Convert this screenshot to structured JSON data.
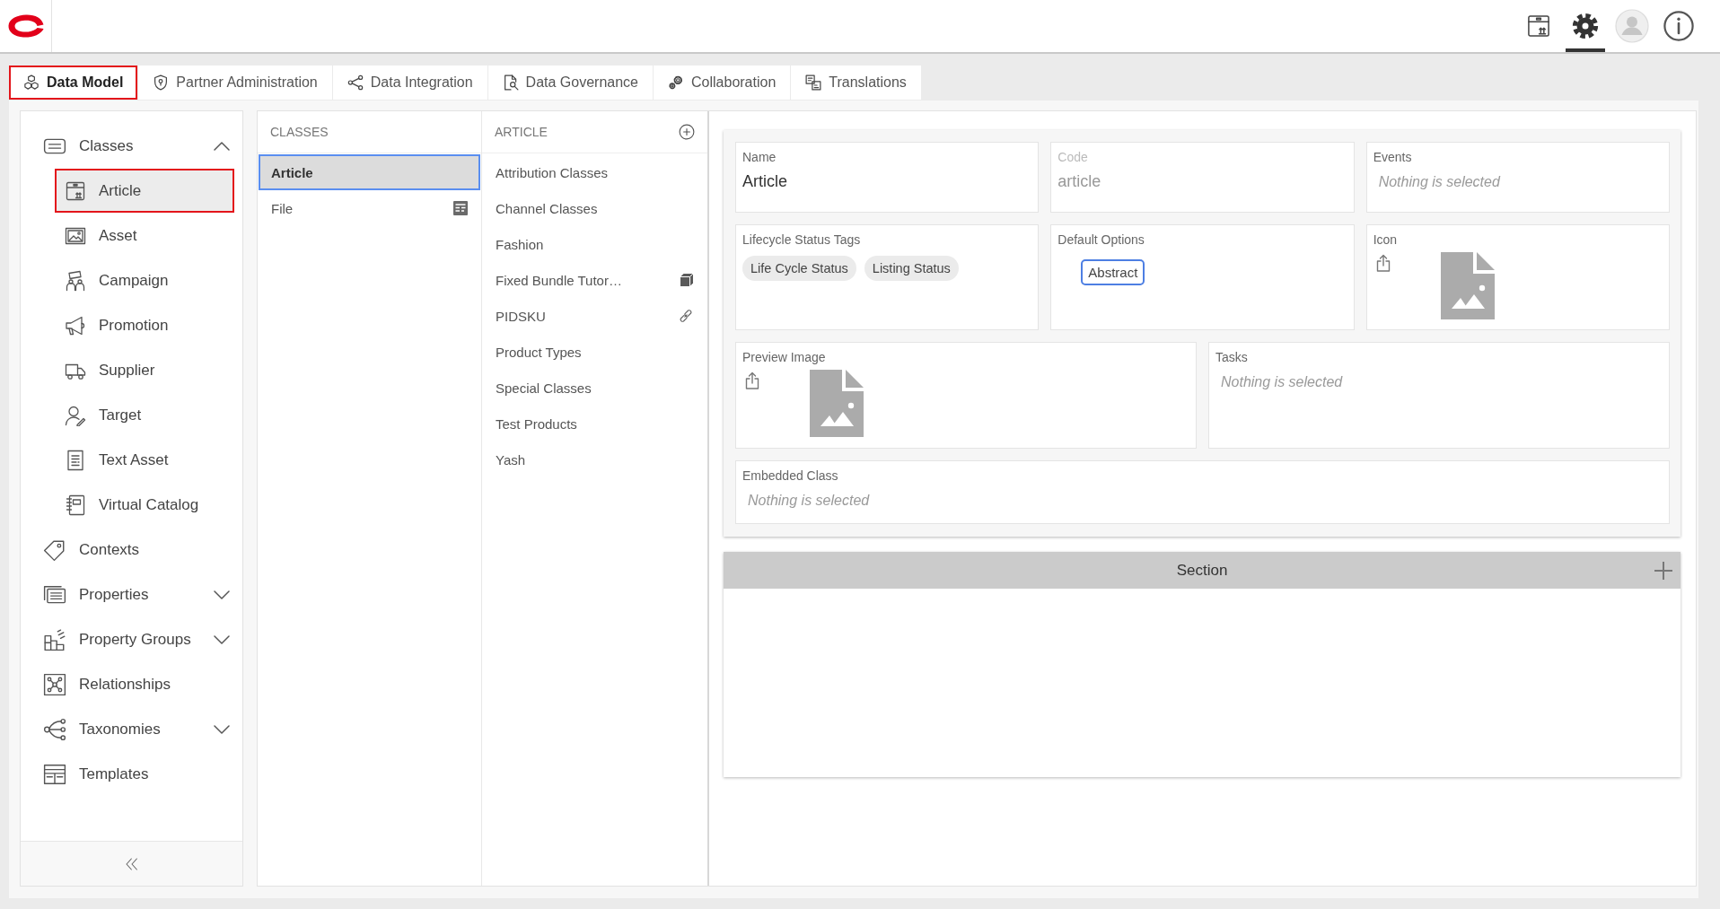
{
  "top_bar": {
    "actions": [
      {
        "kind": "package",
        "selected": false
      },
      {
        "kind": "settings",
        "selected": true
      },
      {
        "kind": "avatar",
        "selected": false
      },
      {
        "kind": "info",
        "selected": false
      }
    ]
  },
  "tabs": [
    {
      "label": "Data Model",
      "selected": true
    },
    {
      "label": "Partner Administration",
      "selected": false
    },
    {
      "label": "Data Integration",
      "selected": false
    },
    {
      "label": "Data Governance",
      "selected": false
    },
    {
      "label": "Collaboration",
      "selected": false
    },
    {
      "label": "Translations",
      "selected": false
    }
  ],
  "sidebar": {
    "items": [
      {
        "label": "Classes",
        "selected": false,
        "expanded": true,
        "children": [
          {
            "label": "Article",
            "selected": true
          },
          {
            "label": "Asset",
            "selected": false
          },
          {
            "label": "Campaign",
            "selected": false
          },
          {
            "label": "Promotion",
            "selected": false
          },
          {
            "label": "Supplier",
            "selected": false
          },
          {
            "label": "Target",
            "selected": false
          },
          {
            "label": "Text Asset",
            "selected": false
          },
          {
            "label": "Virtual Catalog",
            "selected": false
          }
        ]
      },
      {
        "label": "Contexts",
        "selected": false
      },
      {
        "label": "Properties",
        "selected": false,
        "expanded": false
      },
      {
        "label": "Property Groups",
        "selected": false,
        "expanded": false
      },
      {
        "label": "Relationships",
        "selected": false
      },
      {
        "label": "Taxonomies",
        "selected": false,
        "expanded": false
      },
      {
        "label": "Templates",
        "selected": false
      }
    ]
  },
  "classes_column": {
    "title": "CLASSES",
    "items": [
      {
        "label": "Article",
        "selected": true,
        "kind": "plain"
      },
      {
        "label": "File",
        "selected": false,
        "kind": "template"
      }
    ]
  },
  "article_column": {
    "title": "ARTICLE",
    "items": [
      {
        "label": "Attribution Classes",
        "selected": false,
        "kind": "plain"
      },
      {
        "label": "Channel Classes",
        "selected": false,
        "kind": "plain"
      },
      {
        "label": "Fashion",
        "selected": false,
        "kind": "plain"
      },
      {
        "label": "Fixed Bundle Tutor…",
        "selected": false,
        "kind": "bundle"
      },
      {
        "label": "PIDSKU",
        "selected": false,
        "kind": "linked"
      },
      {
        "label": "Product Types",
        "selected": false,
        "kind": "plain"
      },
      {
        "label": "Special Classes",
        "selected": false,
        "kind": "plain"
      },
      {
        "label": "Test Products",
        "selected": false,
        "kind": "plain"
      },
      {
        "label": "Yash",
        "selected": false,
        "kind": "plain"
      }
    ]
  },
  "details": {
    "rows": [
      [
        {
          "kind": "text",
          "label": "Name",
          "value": "Article",
          "disabled": false
        },
        {
          "kind": "text",
          "label": "Code",
          "value": "article",
          "disabled": true
        },
        {
          "kind": "select",
          "label": "Events",
          "placeholder": "Nothing is selected",
          "disabled": false
        }
      ],
      [
        {
          "kind": "tags",
          "label": "Lifecycle Status Tags",
          "tags": [
            "Life Cycle Status",
            "Listing Status"
          ],
          "disabled": false
        },
        {
          "kind": "options",
          "label": "Default Options",
          "options": [
            {
              "label": "Abstract",
              "selected": true
            }
          ],
          "disabled": false
        },
        {
          "kind": "image",
          "label": "Icon",
          "disabled": false
        }
      ],
      [
        {
          "kind": "image",
          "label": "Preview Image",
          "disabled": false
        },
        {
          "kind": "select",
          "label": "Tasks",
          "placeholder": "Nothing is selected",
          "disabled": false
        }
      ],
      [
        {
          "kind": "select",
          "label": "Embedded Class",
          "placeholder": "Nothing is selected",
          "disabled": false
        }
      ]
    ]
  },
  "section": {
    "title": "Section"
  }
}
